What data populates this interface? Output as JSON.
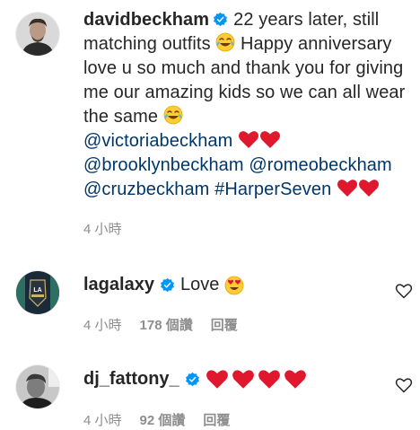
{
  "caption": {
    "username": "davidbeckham",
    "text_part1": "22 years later, still matching outfits",
    "text_part2": "Happy anniversary love u so much and thank you for giving me our amazing kids so we can all wear the same",
    "mentions": [
      "@victoriabeckham",
      "@brooklynbeckham",
      "@romeobeckham",
      "@cruzbeckham",
      "#HarperSeven"
    ],
    "time": "4 小時"
  },
  "comments": [
    {
      "username": "lagalaxy",
      "text": "Love",
      "time": "4 小時",
      "likes": "178 個讚",
      "reply_label": "回覆"
    },
    {
      "username": "dj_fattony_",
      "text": "",
      "time": "4 小時",
      "likes": "92 個讚",
      "reply_label": "回覆"
    }
  ],
  "icons": {
    "verified": "verified-badge-icon",
    "like": "heart-outline-icon",
    "emoji_laugh": "face-with-tears-of-joy-emoji",
    "emoji_heart": "red-heart-emoji",
    "emoji_love": "smiling-face-with-heart-eyes-emoji"
  },
  "colors": {
    "text": "#262626",
    "secondary": "#8e8e8e",
    "mention": "#00376b",
    "verified": "#0095f6",
    "heart": "#ed4956"
  }
}
